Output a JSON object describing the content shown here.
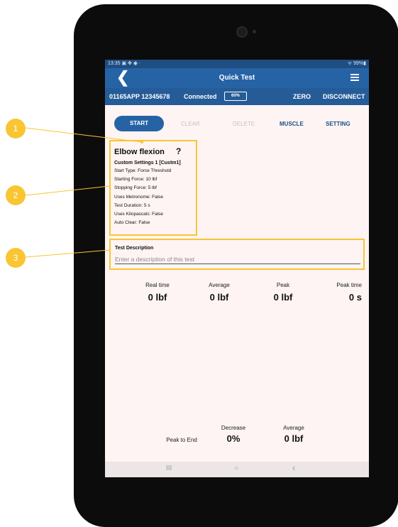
{
  "statusbar": {
    "time": "13:35 ▣ ✤ ◉ ·",
    "battery": "ᯤ 99%▮"
  },
  "titlebar": {
    "back_glyph": "❮",
    "title": "Quick Test"
  },
  "devicebar": {
    "device_id": "01165APP 12345678",
    "connection": "Connected",
    "battery": "60%",
    "zero": "ZERO",
    "disconnect": "DISCONNECT"
  },
  "buttons": {
    "start": "START",
    "clear": "CLEAR",
    "delete": "DELETE",
    "muscle": "MUSCLE",
    "setting": "SETTING"
  },
  "test": {
    "muscle": "Elbow flexion",
    "help": "?",
    "custom_settings": "Custom Settings 1 [Custm1]",
    "settings": [
      "Start Type: Force Threshold",
      "Starting Force: 10 lbf",
      "Stopping Force: 5 lbf",
      "Uses Metronome: False",
      "Test Duration: 5 s",
      "Uses Kilopascals: False",
      "Auto Clear: False"
    ]
  },
  "description": {
    "label": "Test Description",
    "placeholder": "Enter a description of this test"
  },
  "stats": [
    {
      "label": "Real time",
      "value": "0 lbf"
    },
    {
      "label": "Average",
      "value": "0 lbf"
    },
    {
      "label": "Peak",
      "value": "0 lbf"
    },
    {
      "label": "Peak time",
      "value": "0 s"
    }
  ],
  "summary": {
    "peak_to_end_label": "Peak to End",
    "decrease_label": "Decrease",
    "decrease_value": "0%",
    "average_label": "Average",
    "average_value": "0 lbf"
  },
  "navbar": {
    "recents": "III",
    "home": "○",
    "back": "‹"
  },
  "callouts": [
    "1",
    "2",
    "3"
  ],
  "colors": {
    "accent": "#2663a5",
    "callout": "#f9c532",
    "screen_bg": "#fdf4f3"
  }
}
